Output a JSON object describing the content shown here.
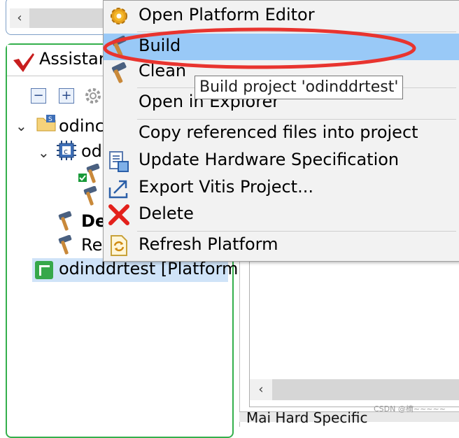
{
  "assistant": {
    "title": "Assistan",
    "tree": {
      "system_node": "odinc",
      "component_node": "od",
      "item_de": "De",
      "item_re": "Re",
      "platform_node": "odinddrtest [Platform"
    }
  },
  "context_menu": {
    "items": [
      {
        "label": "Open Platform Editor",
        "icon": "gear-icon"
      },
      {
        "label": "Build",
        "icon": "hammer-icon",
        "selected": true
      },
      {
        "label": "Clean",
        "icon": "hammer-icon"
      },
      {
        "label": "Open in Explorer",
        "icon": ""
      },
      {
        "label": "Copy referenced files into project",
        "icon": ""
      },
      {
        "label": "Update Hardware Specification",
        "icon": "hardware-spec-icon"
      },
      {
        "label": "Export Vitis Project...",
        "icon": "export-icon"
      },
      {
        "label": "Delete",
        "icon": "delete-x-icon"
      },
      {
        "label": "Refresh Platform",
        "icon": "refresh-icon"
      }
    ]
  },
  "tooltip": {
    "text": "Build project 'odinddrtest'"
  },
  "bottom_tabs": {
    "text": "Mai   Hard    Specific"
  },
  "watermark": {
    "text": "CSDN @楠~~~~~"
  },
  "colors": {
    "menu_selection": "#99c9f7",
    "annotation_red": "#e8342f",
    "panel_green": "#34b04c"
  }
}
